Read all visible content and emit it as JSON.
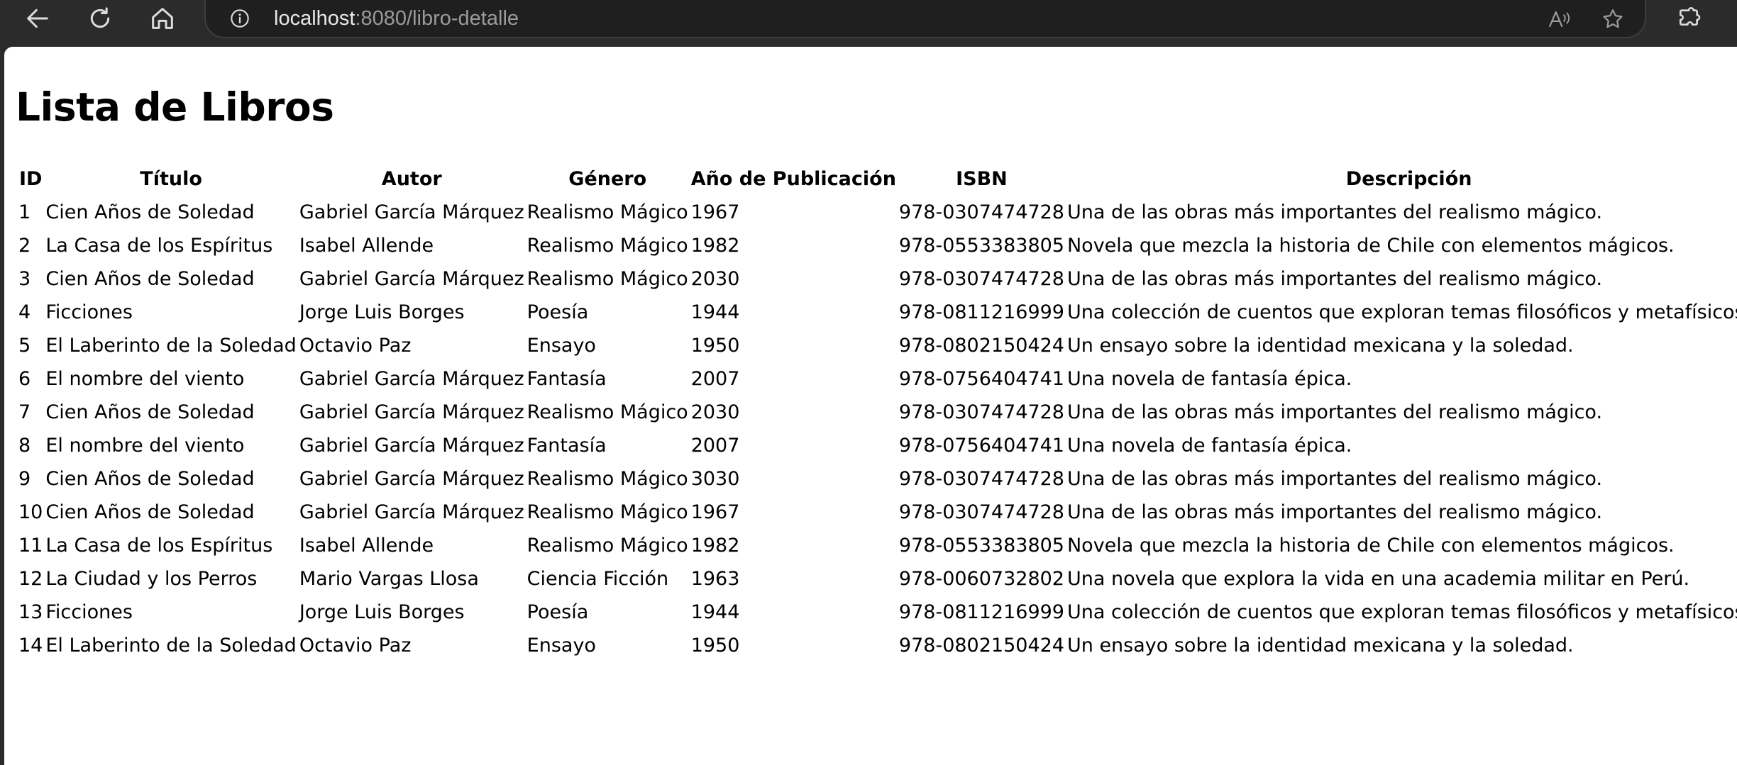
{
  "browser": {
    "url_host": "localhost",
    "url_path": ":8080/libro-detalle",
    "icons": {
      "back": "back-arrow-icon",
      "reload": "reload-icon",
      "home": "home-icon",
      "site_info": "info-icon",
      "read_aloud": "read-aloud-icon",
      "favorite": "star-icon",
      "extensions": "extensions-icon"
    }
  },
  "page": {
    "title": "Lista de Libros"
  },
  "table": {
    "headers": [
      "ID",
      "Título",
      "Autor",
      "Género",
      "Año de Publicación",
      "ISBN",
      "Descripción"
    ],
    "rows": [
      [
        "1",
        "Cien Años de Soledad",
        "Gabriel García Márquez",
        "Realismo Mágico",
        "1967",
        "978-0307474728",
        "Una de las obras más importantes del realismo mágico."
      ],
      [
        "2",
        "La Casa de los Espíritus",
        "Isabel Allende",
        "Realismo Mágico",
        "1982",
        "978-0553383805",
        "Novela que mezcla la historia de Chile con elementos mágicos."
      ],
      [
        "3",
        "Cien Años de Soledad",
        "Gabriel García Márquez",
        "Realismo Mágico",
        "2030",
        "978-0307474728",
        "Una de las obras más importantes del realismo mágico."
      ],
      [
        "4",
        "Ficciones",
        "Jorge Luis Borges",
        "Poesía",
        "1944",
        "978-0811216999",
        "Una colección de cuentos que exploran temas filosóficos y metafísicos."
      ],
      [
        "5",
        "El Laberinto de la Soledad",
        "Octavio Paz",
        "Ensayo",
        "1950",
        "978-0802150424",
        "Un ensayo sobre la identidad mexicana y la soledad."
      ],
      [
        "6",
        "El nombre del viento",
        "Gabriel García Márquez",
        "Fantasía",
        "2007",
        "978-0756404741",
        "Una novela de fantasía épica."
      ],
      [
        "7",
        "Cien Años de Soledad",
        "Gabriel García Márquez",
        "Realismo Mágico",
        "2030",
        "978-0307474728",
        "Una de las obras más importantes del realismo mágico."
      ],
      [
        "8",
        "El nombre del viento",
        "Gabriel García Márquez",
        "Fantasía",
        "2007",
        "978-0756404741",
        "Una novela de fantasía épica."
      ],
      [
        "9",
        "Cien Años de Soledad",
        "Gabriel García Márquez",
        "Realismo Mágico",
        "3030",
        "978-0307474728",
        "Una de las obras más importantes del realismo mágico."
      ],
      [
        "10",
        "Cien Años de Soledad",
        "Gabriel García Márquez",
        "Realismo Mágico",
        "1967",
        "978-0307474728",
        "Una de las obras más importantes del realismo mágico."
      ],
      [
        "11",
        "La Casa de los Espíritus",
        "Isabel Allende",
        "Realismo Mágico",
        "1982",
        "978-0553383805",
        "Novela que mezcla la historia de Chile con elementos mágicos."
      ],
      [
        "12",
        "La Ciudad y los Perros",
        "Mario Vargas Llosa",
        "Ciencia Ficción",
        "1963",
        "978-0060732802",
        "Una novela que explora la vida en una academia militar en Perú."
      ],
      [
        "13",
        "Ficciones",
        "Jorge Luis Borges",
        "Poesía",
        "1944",
        "978-0811216999",
        "Una colección de cuentos que exploran temas filosóficos y metafísicos."
      ],
      [
        "14",
        "El Laberinto de la Soledad",
        "Octavio Paz",
        "Ensayo",
        "1950",
        "978-0802150424",
        "Un ensayo sobre la identidad mexicana y la soledad."
      ]
    ]
  }
}
